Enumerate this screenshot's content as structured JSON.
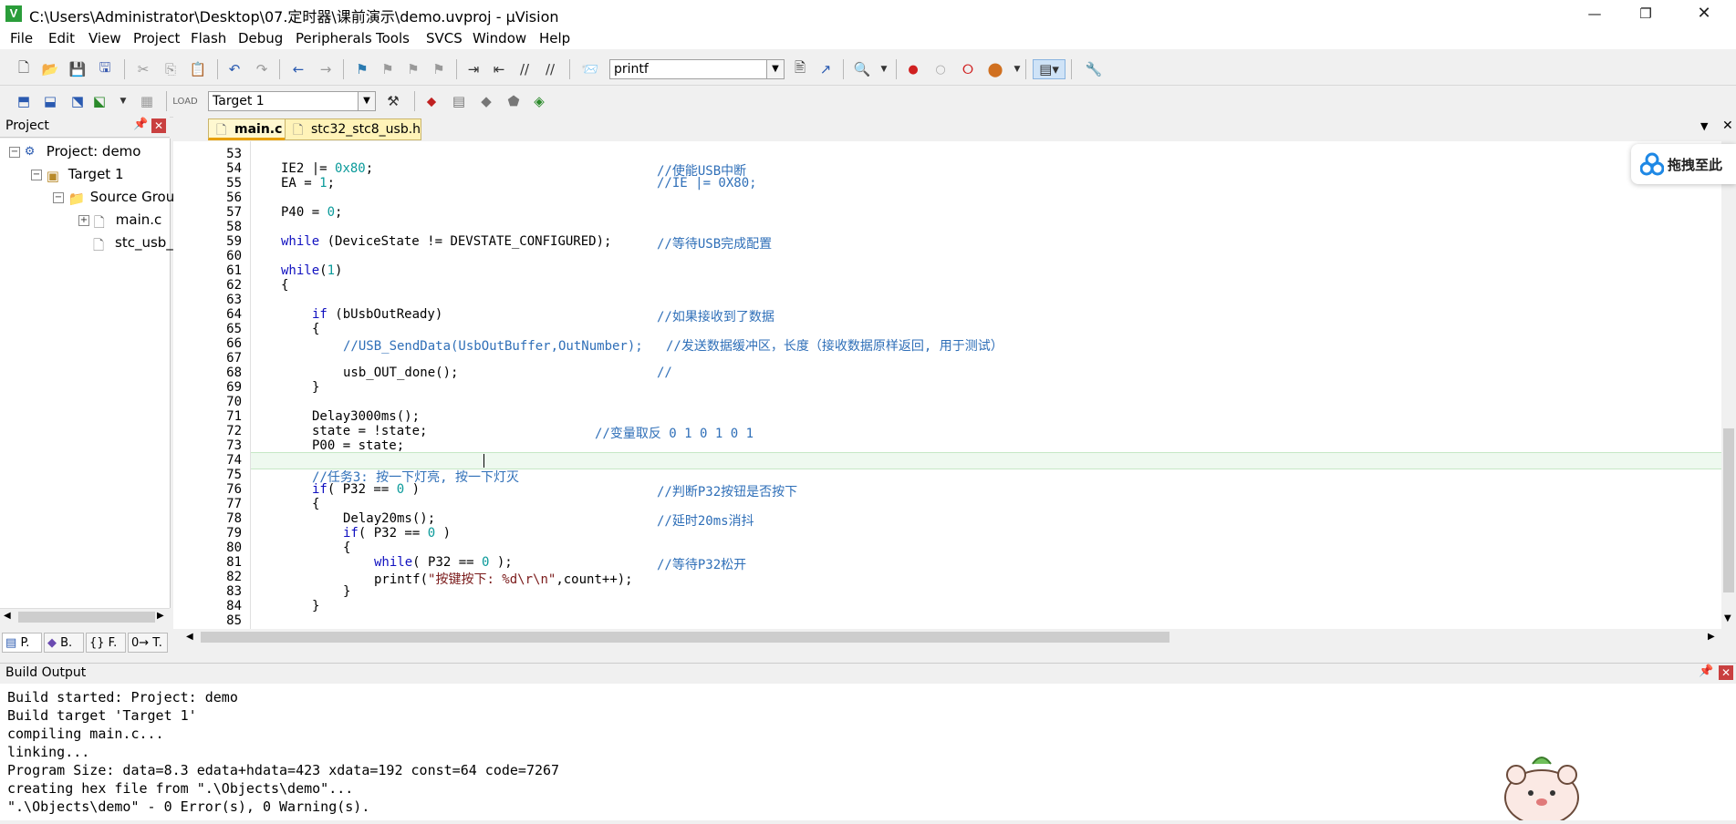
{
  "title_bar": {
    "title": "C:\\Users\\Administrator\\Desktop\\07.定时器\\课前演示\\demo.uvproj - µVision",
    "app_icon": "V"
  },
  "menu": [
    "File",
    "Edit",
    "View",
    "Project",
    "Flash",
    "Debug",
    "Peripherals",
    "Tools",
    "SVCS",
    "Window",
    "Help"
  ],
  "toolbar1": {
    "find_combo_value": "printf"
  },
  "toolbar2": {
    "target_combo_value": "Target 1"
  },
  "project_panel": {
    "title": "Project",
    "tree": {
      "project": "Project: demo",
      "target": "Target 1",
      "group": "Source Grou",
      "files": [
        "main.c",
        "stc_usb_"
      ]
    },
    "tabs": [
      "P.",
      "B.",
      "{} F.",
      "0→ T."
    ]
  },
  "editor": {
    "tabs": [
      "main.c",
      "stc32_stc8_usb.h"
    ],
    "lines": [
      {
        "n": "53"
      },
      {
        "n": "54"
      },
      {
        "n": "55"
      },
      {
        "n": "56"
      },
      {
        "n": "57"
      },
      {
        "n": "58"
      },
      {
        "n": "59"
      },
      {
        "n": "60"
      },
      {
        "n": "61"
      },
      {
        "n": "62"
      },
      {
        "n": "63"
      },
      {
        "n": "64"
      },
      {
        "n": "65"
      },
      {
        "n": "66"
      },
      {
        "n": "67"
      },
      {
        "n": "68"
      },
      {
        "n": "69"
      },
      {
        "n": "70"
      },
      {
        "n": "71"
      },
      {
        "n": "72"
      },
      {
        "n": "73"
      },
      {
        "n": "74"
      },
      {
        "n": "75"
      },
      {
        "n": "76"
      },
      {
        "n": "77"
      },
      {
        "n": "78"
      },
      {
        "n": "79"
      },
      {
        "n": "80"
      },
      {
        "n": "81"
      },
      {
        "n": "82"
      },
      {
        "n": "83"
      },
      {
        "n": "84"
      },
      {
        "n": "85"
      }
    ],
    "code": {
      "l54a": "IE2 |= ",
      "l54b": "0x80",
      "l54c": ";",
      "l54cm": "//使能USB中断",
      "l55a": "EA = ",
      "l55b": "1",
      "l55c": ";",
      "l55cm": "//IE |= 0X80;",
      "l57a": "P40 = ",
      "l57b": "0",
      "l57c": ";",
      "l59kw": "while",
      "l59a": " (DeviceState != DEVSTATE_CONFIGURED);",
      "l59cm": "//等待USB完成配置",
      "l61kw": "while",
      "l61a": "(",
      "l61b": "1",
      "l61c": ")",
      "l62": "{",
      "l64kw": "if",
      "l64a": " (bUsbOutReady)",
      "l64cm": "//如果接收到了数据",
      "l65": "{",
      "l66cm": "//USB_SendData(UsbOutBuffer,OutNumber);   //发送数据缓冲区，长度（接收数据原样返回, 用于测试）",
      "l68a": "usb_OUT_done();",
      "l68cm": "//",
      "l69": "}",
      "l71": "Delay3000ms();",
      "l72a": "state = !state;",
      "l72cm": "//变量取反 0 1 0 1 0 1",
      "l73": "P00 = state;",
      "l75cm": "//任务3: 按一下灯亮, 按一下灯灭",
      "l76kw": "if",
      "l76a": "( P32 == ",
      "l76b": "0",
      "l76c": " )",
      "l76cm": "//判断P32按钮是否按下",
      "l77": "{",
      "l78a": "Delay20ms();",
      "l78cm": "//延时20ms消抖",
      "l79kw": "if",
      "l79a": "( P32 == ",
      "l79b": "0",
      "l79c": " )",
      "l80": "{",
      "l81kw": "while",
      "l81a": "( P32 == ",
      "l81b": "0",
      "l81c": " );",
      "l81cm": "//等待P32松开",
      "l82a": "printf(",
      "l82s": "\"按键按下: %d\\r\\n\"",
      "l82c": ",count++);",
      "l83": "}",
      "l84": "}"
    }
  },
  "build_output": {
    "title": "Build Output",
    "lines": [
      "Build started: Project: demo",
      "Build target 'Target 1'",
      "compiling main.c...",
      "linking...",
      "Program Size: data=8.3 edata+hdata=423 xdata=192 const=64 code=7267",
      "creating hex file from \".\\Objects\\demo\"...",
      "\".\\Objects\\demo\" - 0 Error(s), 0 Warning(s)."
    ]
  },
  "drag_widget": {
    "label": "拖拽至此"
  },
  "colors": {
    "comment": "#2f6fb8",
    "keyword": "#1010c0",
    "number": "#0a9a9a",
    "tab_active": "#fff3b8"
  }
}
